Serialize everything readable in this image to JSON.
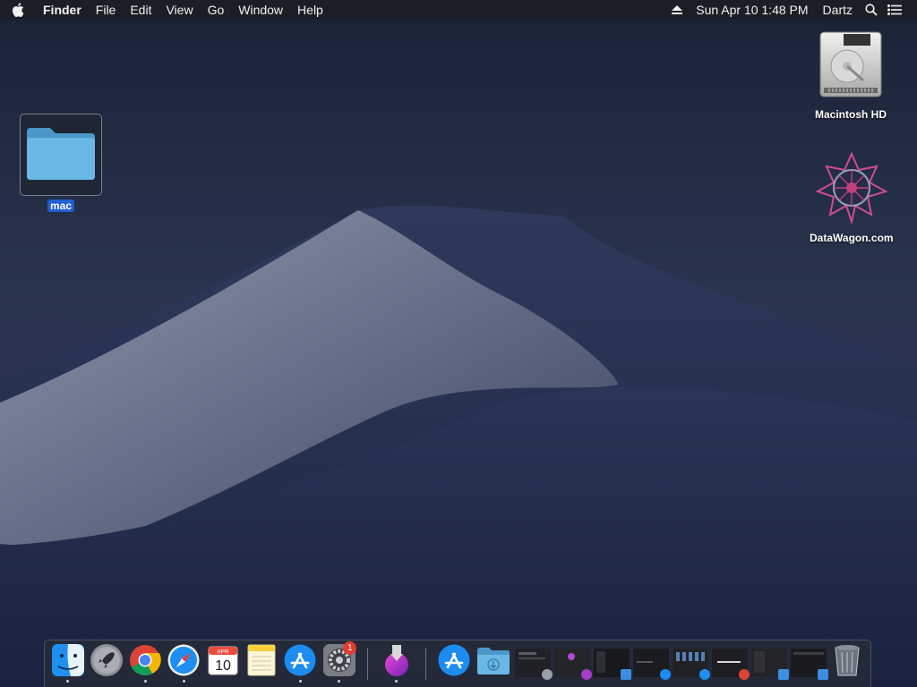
{
  "menubar": {
    "apple_icon": "apple-icon",
    "app_name": "Finder",
    "menus": [
      "File",
      "Edit",
      "View",
      "Go",
      "Window",
      "Help"
    ],
    "clock": "Sun Apr 10  1:48 PM",
    "user": "Dartz",
    "status_icons": [
      "eject-icon",
      "spotlight-icon",
      "notification-center-icon"
    ]
  },
  "desktop": {
    "items": [
      {
        "label": "Macintosh HD",
        "icon": "hard-drive-icon"
      },
      {
        "label": "DataWagon.com",
        "icon": "datawagon-logo-icon"
      },
      {
        "label": "mac",
        "icon": "folder-icon",
        "selected": true
      }
    ]
  },
  "dock": {
    "apps": [
      {
        "name": "Finder",
        "icon": "finder-icon",
        "running": true
      },
      {
        "name": "Launchpad",
        "icon": "launchpad-icon",
        "running": false
      },
      {
        "name": "Google Chrome",
        "icon": "chrome-icon",
        "running": true
      },
      {
        "name": "Safari",
        "icon": "safari-icon",
        "running": true
      },
      {
        "name": "Calendar",
        "icon": "calendar-icon",
        "running": false,
        "month": "APR",
        "day": "10"
      },
      {
        "name": "Notes",
        "icon": "notes-icon",
        "running": false
      },
      {
        "name": "App Store",
        "icon": "app-store-icon",
        "running": true
      },
      {
        "name": "System Preferences",
        "icon": "system-preferences-icon",
        "running": true,
        "badge": "1"
      },
      {
        "name": "Installer",
        "icon": "installer-icon",
        "running": true
      }
    ],
    "others": [
      {
        "name": "App Store",
        "icon": "app-store-icon"
      },
      {
        "name": "Downloads",
        "icon": "downloads-folder-icon"
      },
      {
        "name": "Minimized window",
        "icon": "minimized-window-icon"
      },
      {
        "name": "Minimized window",
        "icon": "minimized-window-icon"
      },
      {
        "name": "Minimized window",
        "icon": "minimized-window-icon"
      },
      {
        "name": "Minimized window",
        "icon": "minimized-window-icon"
      },
      {
        "name": "Minimized window",
        "icon": "minimized-window-icon"
      },
      {
        "name": "Minimized window",
        "icon": "minimized-window-icon"
      },
      {
        "name": "Minimized window",
        "icon": "minimized-window-icon"
      },
      {
        "name": "Minimized window",
        "icon": "minimized-window-icon"
      },
      {
        "name": "Trash",
        "icon": "trash-icon"
      }
    ]
  },
  "colors": {
    "accent": "#1f5fd1",
    "sky": "#1d2740",
    "dune": "#6c7489",
    "badge": "#e53b30"
  }
}
